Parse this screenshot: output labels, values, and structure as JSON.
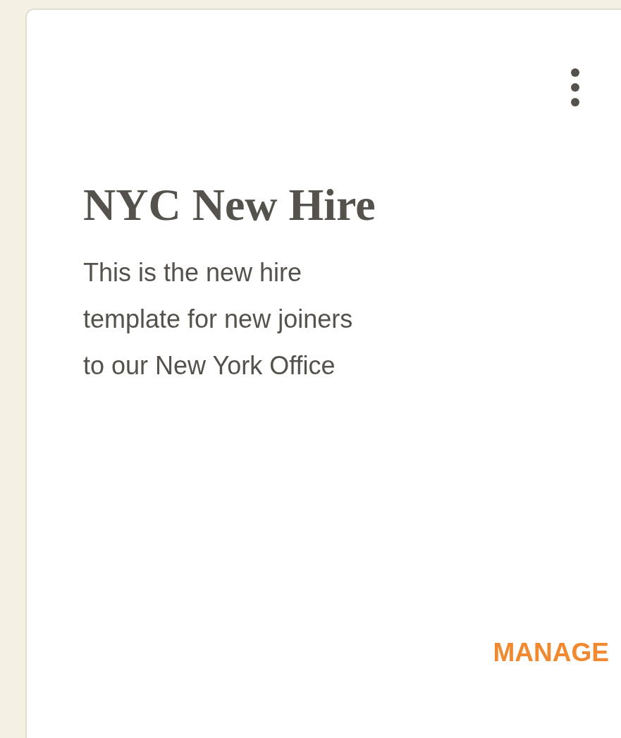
{
  "card": {
    "title": "NYC New Hire",
    "description": "This is the new hire template for new joiners to our New York Office",
    "action": "MANAGE"
  }
}
